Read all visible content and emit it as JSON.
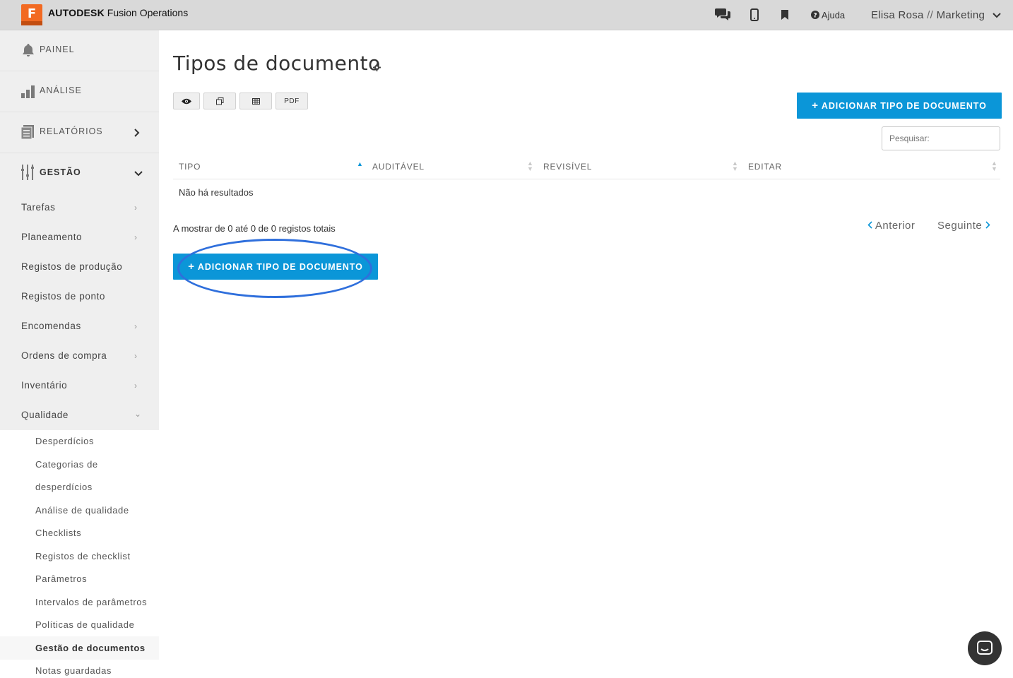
{
  "brand": {
    "logo_letter": "F",
    "name_bold": "AUTODESK",
    "name_rest": "Fusion Operations"
  },
  "topbar": {
    "icons": [
      "chat-icon",
      "mobile-icon",
      "bookmark-icon"
    ],
    "help_label": "Ajuda",
    "user_name": "Elisa Rosa",
    "user_sep": "//",
    "user_dept": "Marketing"
  },
  "sidebar": {
    "sections": [
      {
        "label": "PAINEL",
        "icon": "bell-icon"
      },
      {
        "label": "ANÁLISE",
        "icon": "bar-chart-icon"
      },
      {
        "label": "RELATÓRIOS",
        "icon": "report-icon",
        "chevron": "›"
      },
      {
        "label": "GESTÃO",
        "icon": "sliders-icon",
        "chevron": "⌄"
      }
    ],
    "items": [
      {
        "label": "Tarefas",
        "chevron": "›"
      },
      {
        "label": "Planeamento",
        "chevron": "›"
      },
      {
        "label": "Registos de produção"
      },
      {
        "label": "Registos de ponto"
      },
      {
        "label": "Encomendas",
        "chevron": "›"
      },
      {
        "label": "Ordens de compra",
        "chevron": "›"
      },
      {
        "label": "Inventário",
        "chevron": "›"
      },
      {
        "label": "Qualidade",
        "chevron": "⌄"
      }
    ],
    "quality_items": [
      "Desperdícios",
      "Categorias de",
      "desperdícios",
      "Análise de qualidade",
      "Checklists",
      "Registos de checklist",
      "Parâmetros",
      "Intervalos de parâmetros",
      "Políticas de qualidade",
      "Gestão de documentos",
      "Notas guardadas"
    ],
    "active_item": "Gestão de documentos"
  },
  "main": {
    "title": "Tipos de documento",
    "toolbar": {
      "pdf_label": "PDF",
      "icons": [
        "eye-icon",
        "copy-icon",
        "table-icon"
      ]
    },
    "add_button_label": "ADICIONAR TIPO DE DOCUMENTO",
    "add_button_icon": "+",
    "search_placeholder": "Pesquisar:",
    "table": {
      "columns": [
        "TIPO",
        "AUDITÁVEL",
        "REVISÍVEL",
        "EDITAR"
      ],
      "sorted_column": "TIPO",
      "sort_direction": "asc",
      "empty_message": "Não há resultados"
    },
    "info_text": "A mostrar de 0 até 0 de 0 registos totais",
    "pager": {
      "prev": "Anterior",
      "next": "Seguinte"
    },
    "highlight_color": "#2f6fdc",
    "accent_color": "#0b96d8"
  }
}
